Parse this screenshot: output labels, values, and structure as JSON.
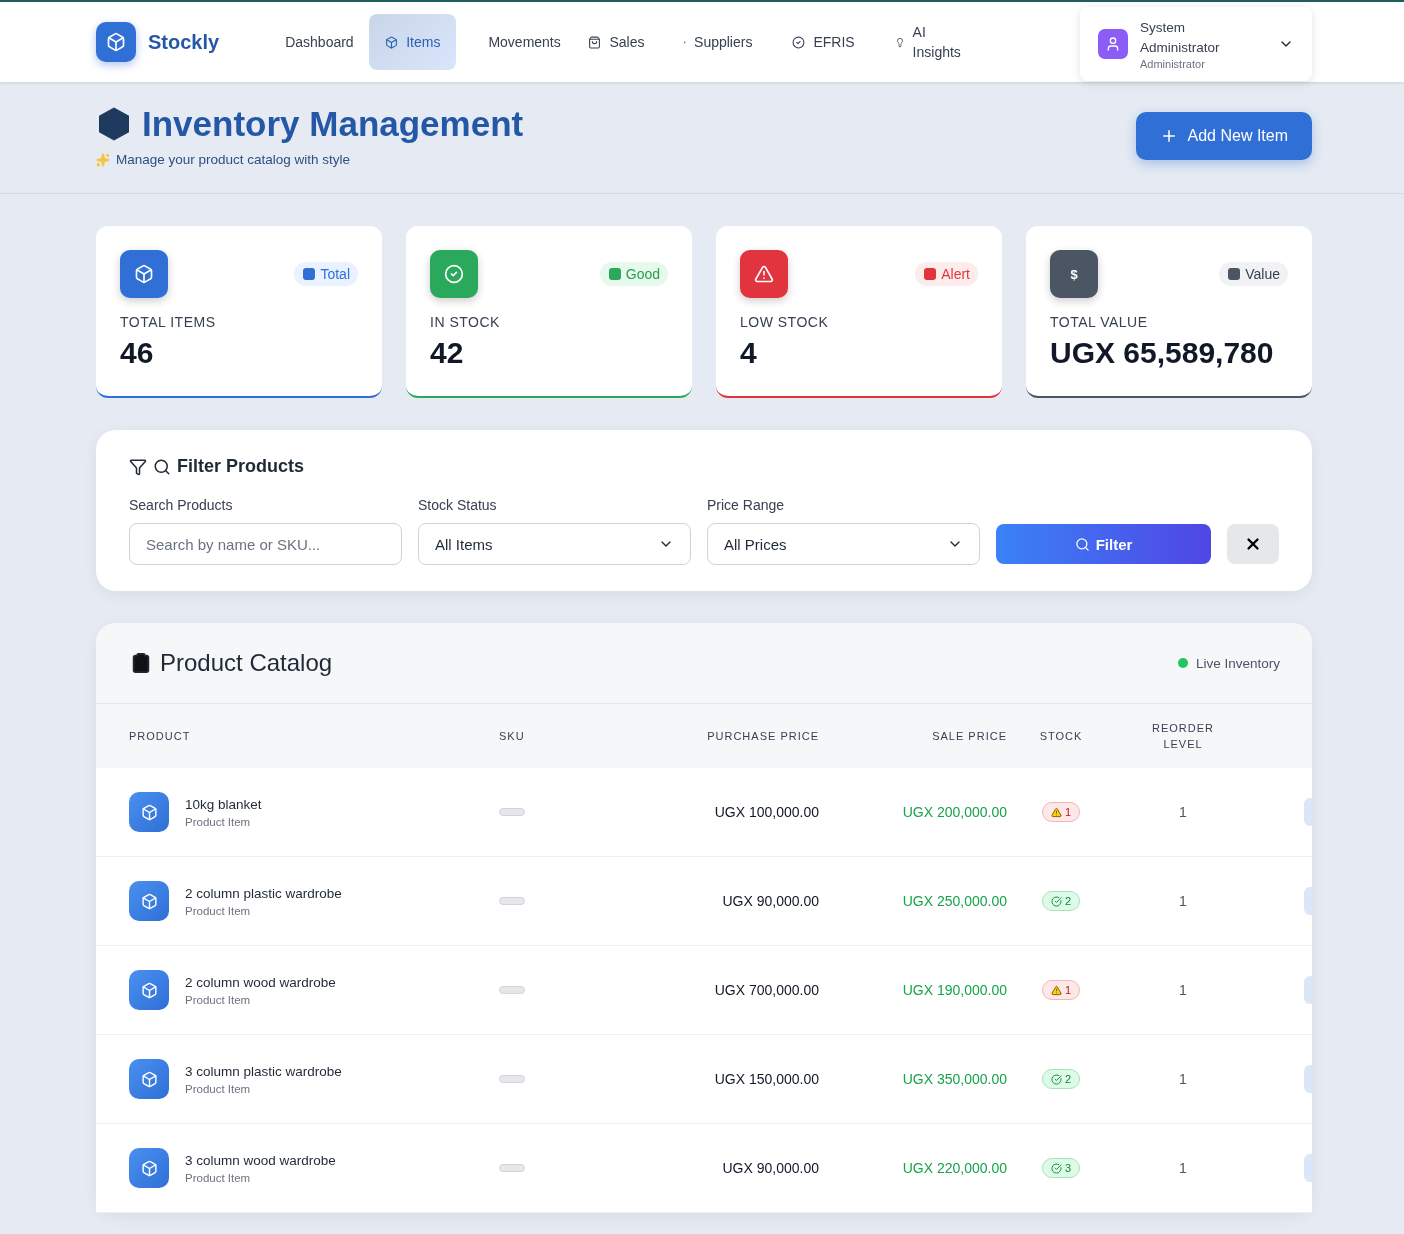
{
  "brand": "Stockly",
  "nav": [
    {
      "label": "Dashboard",
      "selected": false
    },
    {
      "label": "Items",
      "selected": true
    },
    {
      "label": "Movements",
      "selected": false
    },
    {
      "label": "Sales",
      "selected": false
    },
    {
      "label": "Suppliers",
      "selected": false
    },
    {
      "label": "EFRIS",
      "selected": false
    },
    {
      "label": "AI Insights",
      "selected": false
    }
  ],
  "user": {
    "name": "System Administrator",
    "role": "Administrator"
  },
  "header": {
    "title": "Inventory Management",
    "subtitle": "Manage your product catalog with style",
    "add_button": "Add New Item"
  },
  "stats": [
    {
      "kind": "total",
      "badge": "Total",
      "label": "TOTAL ITEMS",
      "value": "46"
    },
    {
      "kind": "good",
      "badge": "Good",
      "label": "IN STOCK",
      "value": "42"
    },
    {
      "kind": "alert",
      "badge": "Alert",
      "label": "LOW STOCK",
      "value": "4"
    },
    {
      "kind": "value",
      "icon_text": "$",
      "badge": "Value",
      "label": "TOTAL VALUE",
      "value": "UGX 65,589,780"
    }
  ],
  "filter": {
    "title": "Filter Products",
    "search_label": "Search Products",
    "search_placeholder": "Search by name or SKU...",
    "status_label": "Stock Status",
    "status_value": "All Items",
    "price_label": "Price Range",
    "price_value": "All Prices",
    "filter_button": "Filter"
  },
  "catalog": {
    "title": "Product Catalog",
    "live": "Live Inventory",
    "columns": [
      "PRODUCT",
      "SKU",
      "PURCHASE PRICE",
      "SALE PRICE",
      "STOCK",
      "REORDER LEVEL"
    ],
    "rows": [
      {
        "name": "10kg blanket",
        "type": "Product Item",
        "purchase": "UGX 100,000.00",
        "sale": "UGX 200,000.00",
        "stock": "1",
        "kind": "low",
        "reorder": "1"
      },
      {
        "name": "2 column plastic wardrobe",
        "type": "Product Item",
        "purchase": "UGX 90,000.00",
        "sale": "UGX 250,000.00",
        "stock": "2",
        "kind": "ok",
        "reorder": "1"
      },
      {
        "name": "2 column wood wardrobe",
        "type": "Product Item",
        "purchase": "UGX 700,000.00",
        "sale": "UGX 190,000.00",
        "stock": "1",
        "kind": "low",
        "reorder": "1"
      },
      {
        "name": "3 column plastic wardrobe",
        "type": "Product Item",
        "purchase": "UGX 150,000.00",
        "sale": "UGX 350,000.00",
        "stock": "2",
        "kind": "ok",
        "reorder": "1"
      },
      {
        "name": "3 column wood wardrobe",
        "type": "Product Item",
        "purchase": "UGX 90,000.00",
        "sale": "UGX 220,000.00",
        "stock": "3",
        "kind": "ok",
        "reorder": "1"
      }
    ]
  }
}
